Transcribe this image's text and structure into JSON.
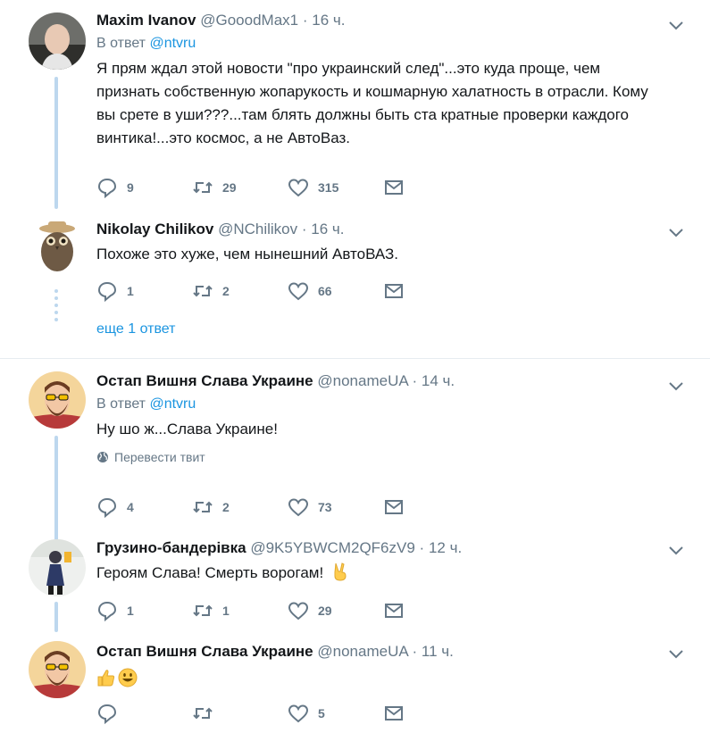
{
  "tweets": [
    {
      "name": "Maxim Ivanov",
      "handle": "@GooodMax1",
      "time": "16 ч.",
      "reply_prefix": "В ответ",
      "reply_handle": "@ntvru",
      "text": "Я прям ждал этой новости \"про украинский след\"...это куда проще, чем признать собственную жопарукость и кошмарную халатность в отрасли. Кому вы срете в уши???...там блять должны быть ста кратные проверки каждого винтика!...это космос, а не АвтоВаз.",
      "replies": "9",
      "retweets": "29",
      "likes": "315"
    },
    {
      "name": "Nikolay Chilikov",
      "handle": "@NChilikov",
      "time": "16 ч.",
      "text": "Похоже это хуже, чем нынешний АвтоВАЗ.",
      "replies": "1",
      "retweets": "2",
      "likes": "66"
    },
    {
      "name": "Остап Вишня Слава Украине",
      "handle": "@nonameUA",
      "time": "14 ч.",
      "reply_prefix": "В ответ",
      "reply_handle": "@ntvru",
      "text": "Ну шо ж...Слава Украине!",
      "translate": "Перевести твит",
      "replies": "4",
      "retweets": "2",
      "likes": "73"
    },
    {
      "name": "Грузино-бандерівка",
      "handle": "@9K5YBWCM2QF6zV9",
      "time": "12 ч.",
      "text": "Героям Слава! Смерть ворогам!",
      "replies": "1",
      "retweets": "1",
      "likes": "29"
    },
    {
      "name": "Остап Вишня Слава Украине",
      "handle": "@nonameUA",
      "time": "11 ч.",
      "text": "",
      "replies": "",
      "retweets": "",
      "likes": "5"
    }
  ],
  "more_replies": "еще 1 ответ",
  "separator": "·",
  "colors": {
    "link": "#1b95e0",
    "muted": "#657786",
    "thread_line": "#bdd7ee",
    "divider": "#e6ecf0"
  },
  "icons": [
    "reply-icon",
    "retweet-icon",
    "like-icon",
    "direct-message-icon",
    "chevron-down-icon",
    "globe-icon"
  ]
}
